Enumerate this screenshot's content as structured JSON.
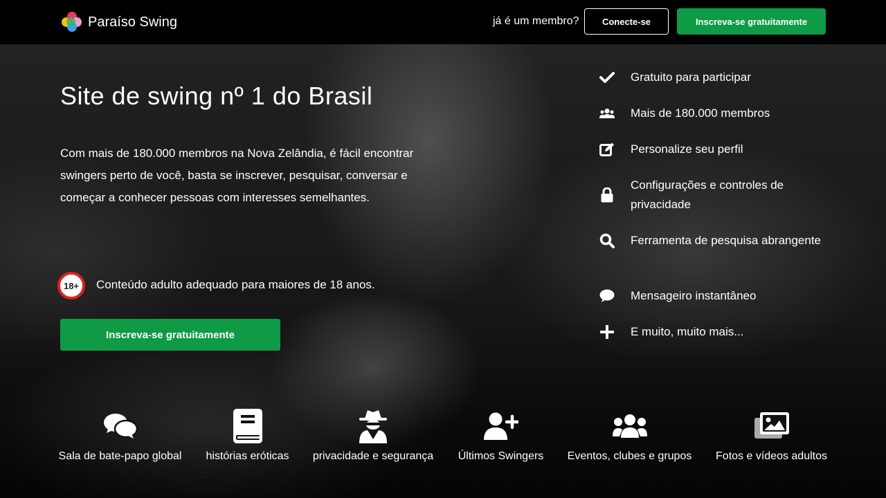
{
  "header": {
    "brand": "Paraíso Swing",
    "member_question": "já é um membro?",
    "login_label": "Conecte-se",
    "signup_label": "Inscreva-se gratuitamente"
  },
  "hero": {
    "title": "Site de swing nº 1 do Brasil",
    "intro": "Com mais de 180.000 membros na Nova Zelândia, é fácil encontrar swingers perto de você, basta se inscrever, pesquisar, conversar e começar a conhecer pessoas com interesses semelhantes.",
    "age_badge": "18+",
    "age_notice": "Conteúdo adulto adequado para maiores de 18 anos.",
    "signup_label": "Inscreva-se gratuitamente"
  },
  "features": [
    {
      "icon": "check-icon",
      "text": "Gratuito para participar"
    },
    {
      "icon": "users-icon",
      "text": "Mais de 180.000 membros"
    },
    {
      "icon": "edit-icon",
      "text": "Personalize seu perfil"
    },
    {
      "icon": "lock-icon",
      "text": "Configurações e controles de privacidade"
    },
    {
      "icon": "search-icon",
      "text": "Ferramenta de pesquisa abrangente"
    },
    {
      "icon": "chat-bubble-icon",
      "text": "Mensageiro instantâneo"
    },
    {
      "icon": "plus-icon",
      "text": "E muito, muito mais..."
    }
  ],
  "bottom_nav": [
    {
      "icon": "chat-bubbles-icon",
      "label": "Sala de bate-papo global"
    },
    {
      "icon": "book-icon",
      "label": "histórias eróticas"
    },
    {
      "icon": "spy-icon",
      "label": "privacidade e segurança"
    },
    {
      "icon": "user-plus-icon",
      "label": "Últimos Swingers"
    },
    {
      "icon": "group-icon",
      "label": "Eventos, clubes e grupos"
    },
    {
      "icon": "images-icon",
      "label": "Fotos e vídeos adultos"
    }
  ],
  "colors": {
    "accent_green": "#0f9a46",
    "badge_red": "#dd2222"
  }
}
